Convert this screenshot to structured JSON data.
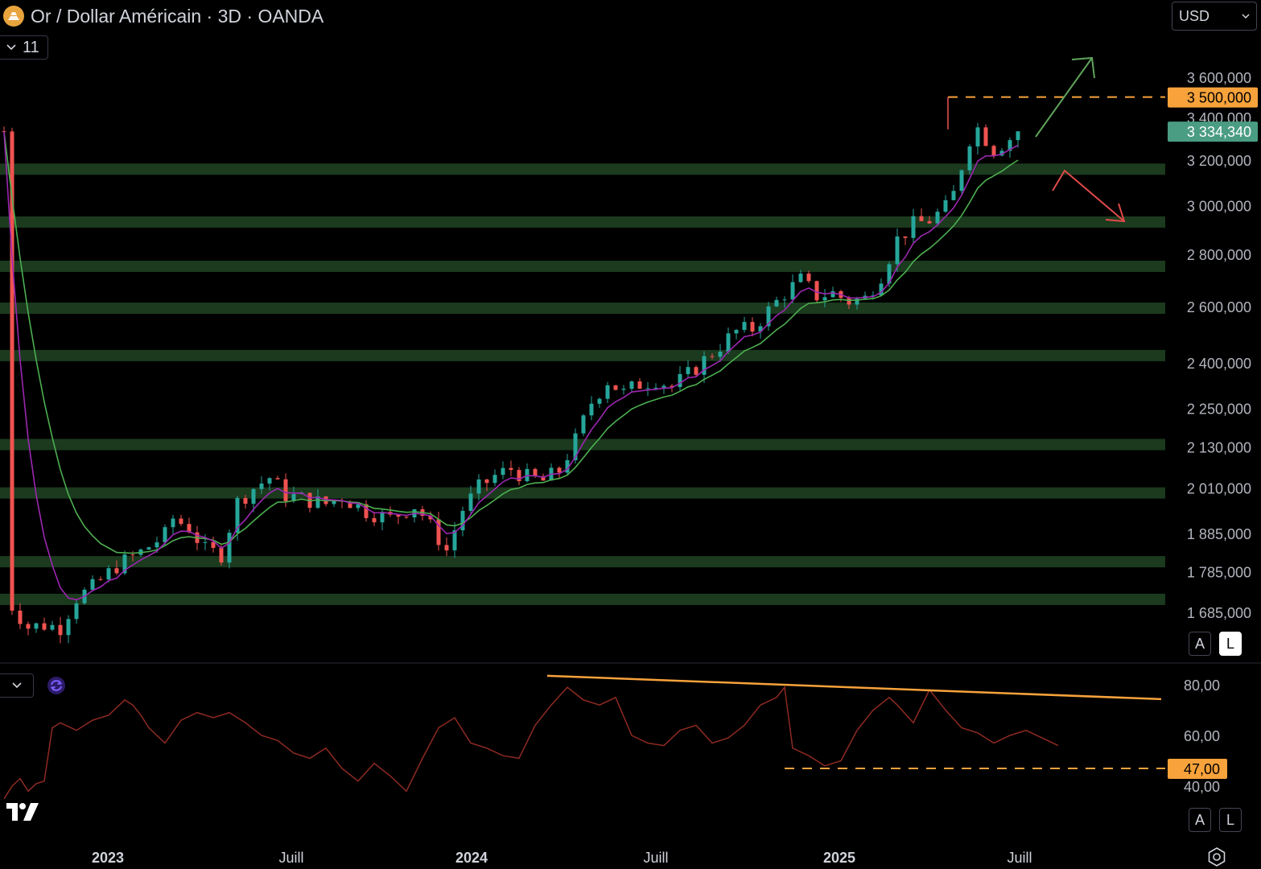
{
  "header": {
    "title": "Or / Dollar Américain · 3D · OANDA",
    "indicator_count": "11",
    "currency": "USD",
    "symbol_icon": "gold-bars-icon"
  },
  "buttons": {
    "auto": "A",
    "log": "L",
    "rsi_auto": "A",
    "rsi_log": "L"
  },
  "colors": {
    "background": "#000000",
    "up_candle": "#26a69a",
    "down_candle": "#ef5350",
    "ma_fast": "#9c27b0",
    "ma_slow": "#4caf50",
    "zone": "#1b3a1e",
    "annotation_orange": "#f7a23b",
    "last_price_badge": "#4a9c82",
    "rsi_line": "#8e2a22",
    "arrow_up": "#5fa35a",
    "arrow_down": "#e04a4a"
  },
  "chart_data": [
    {
      "type": "candlestick",
      "scale": "log",
      "x_labels": [
        "2023",
        "Juill",
        "2024",
        "Juill",
        "2025",
        "Juill"
      ],
      "y_ticks": [
        3600,
        3400,
        3200,
        3000,
        2800,
        2600,
        2400,
        2250,
        2130,
        2010,
        1885,
        1785,
        1685
      ],
      "y_tick_labels": [
        "3 600,000",
        "3 400,000",
        "3 200,000",
        "3 000,000",
        "2 800,000",
        "2 600,000",
        "2 400,000",
        "2 250,000",
        "2 130,000",
        "2 010,000",
        "1 885,000",
        "1 785,000",
        "1 685,000"
      ],
      "ylim": [
        1600,
        3750
      ],
      "last_price": 3334.34,
      "last_price_label": "3 334,340",
      "resistance_level": 3500,
      "resistance_label": "3 500,000",
      "zones": [
        {
          "low": 3140,
          "high": 3185
        },
        {
          "low": 2915,
          "high": 2955
        },
        {
          "low": 2740,
          "high": 2775
        },
        {
          "low": 2585,
          "high": 2615
        },
        {
          "low": 2415,
          "high": 2445
        },
        {
          "low": 2125,
          "high": 2155
        },
        {
          "low": 1985,
          "high": 2012
        },
        {
          "low": 1800,
          "high": 1825
        },
        {
          "low": 1705,
          "high": 1730
        }
      ],
      "price_path": [
        [
          1,
          1700
        ],
        [
          3,
          1650
        ],
        [
          5,
          1655
        ],
        [
          7,
          1650
        ],
        [
          9,
          1720
        ],
        [
          11,
          1745
        ],
        [
          14,
          1800
        ],
        [
          17,
          1835
        ],
        [
          20,
          1880
        ],
        [
          21,
          1925
        ],
        [
          23,
          1900
        ],
        [
          25,
          1840
        ],
        [
          27,
          1830
        ],
        [
          29,
          1970
        ],
        [
          31,
          2010
        ],
        [
          33,
          2040
        ],
        [
          35,
          1990
        ],
        [
          37,
          1980
        ],
        [
          40,
          1965
        ],
        [
          42,
          1985
        ],
        [
          45,
          1945
        ],
        [
          48,
          1925
        ],
        [
          51,
          1960
        ],
        [
          52,
          1935
        ],
        [
          55,
          1840
        ],
        [
          57,
          1950
        ],
        [
          59,
          2010
        ],
        [
          61,
          2045
        ],
        [
          63,
          2065
        ],
        [
          65,
          2040
        ],
        [
          67,
          2030
        ],
        [
          69,
          2060
        ],
        [
          71,
          2150
        ],
        [
          73,
          2270
        ],
        [
          75,
          2340
        ],
        [
          77,
          2300
        ],
        [
          79,
          2330
        ],
        [
          81,
          2345
        ],
        [
          83,
          2320
        ],
        [
          85,
          2360
        ],
        [
          87,
          2410
        ],
        [
          89,
          2460
        ],
        [
          91,
          2510
        ],
        [
          93,
          2520
        ],
        [
          95,
          2585
        ],
        [
          97,
          2650
        ],
        [
          99,
          2700
        ],
        [
          101,
          2640
        ],
        [
          103,
          2650
        ],
        [
          105,
          2620
        ],
        [
          107,
          2630
        ],
        [
          109,
          2720
        ],
        [
          111,
          2860
        ],
        [
          113,
          2920
        ],
        [
          115,
          2940
        ],
        [
          117,
          2990
        ],
        [
          118,
          3050
        ],
        [
          120,
          3300
        ],
        [
          121,
          3350
        ],
        [
          123,
          3250
        ],
        [
          125,
          3300
        ],
        [
          127,
          3320
        ],
        [
          129,
          3380
        ],
        [
          130,
          3330
        ],
        [
          131,
          3334.34
        ]
      ],
      "x_ticks_at": [
        13,
        36,
        59,
        82,
        105,
        128
      ],
      "x_total": 143,
      "rsi": {
        "y_ticks": [
          80,
          60,
          40
        ],
        "y_tick_labels": [
          "80,00",
          "60,00",
          "40,00"
        ],
        "ylim": [
          30,
          84
        ],
        "support_level": 47,
        "support_label": "47,00",
        "divergence_line": [
          [
            68,
            81
          ],
          [
            144,
            74
          ]
        ],
        "path": [
          [
            0,
            35
          ],
          [
            1,
            40
          ],
          [
            2,
            43
          ],
          [
            3,
            38
          ],
          [
            4,
            41
          ],
          [
            5,
            42
          ],
          [
            6,
            63
          ],
          [
            7,
            65
          ],
          [
            9,
            62
          ],
          [
            11,
            66
          ],
          [
            13,
            68
          ],
          [
            15,
            74
          ],
          [
            16,
            72
          ],
          [
            17,
            68
          ],
          [
            18,
            63
          ],
          [
            20,
            57
          ],
          [
            22,
            66
          ],
          [
            24,
            69
          ],
          [
            26,
            67
          ],
          [
            28,
            69
          ],
          [
            30,
            65
          ],
          [
            32,
            60
          ],
          [
            34,
            58
          ],
          [
            36,
            53
          ],
          [
            38,
            51
          ],
          [
            40,
            55
          ],
          [
            42,
            47
          ],
          [
            44,
            42
          ],
          [
            46,
            49
          ],
          [
            48,
            44
          ],
          [
            50,
            38
          ],
          [
            52,
            51
          ],
          [
            54,
            63
          ],
          [
            56,
            67
          ],
          [
            58,
            57
          ],
          [
            60,
            55
          ],
          [
            62,
            52
          ],
          [
            64,
            51
          ],
          [
            66,
            64
          ],
          [
            68,
            72
          ],
          [
            70,
            79
          ],
          [
            72,
            74
          ],
          [
            74,
            72
          ],
          [
            76,
            75
          ],
          [
            78,
            60
          ],
          [
            80,
            57
          ],
          [
            82,
            56
          ],
          [
            84,
            62
          ],
          [
            86,
            64
          ],
          [
            88,
            57
          ],
          [
            90,
            59
          ],
          [
            92,
            64
          ],
          [
            94,
            72
          ],
          [
            96,
            75
          ],
          [
            97,
            79
          ],
          [
            98,
            55
          ],
          [
            100,
            52
          ],
          [
            102,
            48
          ],
          [
            104,
            50
          ],
          [
            106,
            62
          ],
          [
            108,
            70
          ],
          [
            110,
            75
          ],
          [
            111,
            72
          ],
          [
            113,
            65
          ],
          [
            115,
            78
          ],
          [
            117,
            70
          ],
          [
            119,
            63
          ],
          [
            121,
            61
          ],
          [
            123,
            57
          ],
          [
            125,
            60
          ],
          [
            127,
            62
          ],
          [
            129,
            59
          ],
          [
            131,
            56
          ]
        ]
      }
    }
  ]
}
